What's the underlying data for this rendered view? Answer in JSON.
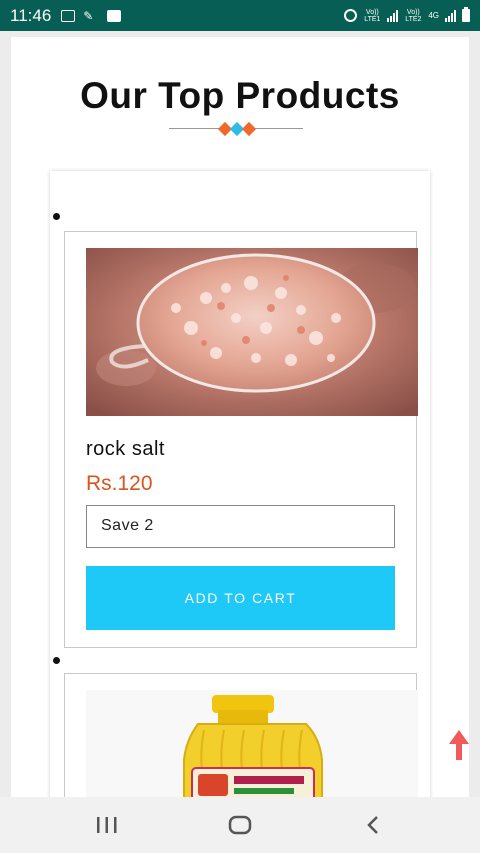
{
  "status_bar": {
    "time": "11:46",
    "sim1_label": "Vo)) LTE1",
    "sim2_label": "Vo)) LTE2",
    "network_type": "4G",
    "icons": [
      "image-icon",
      "magic-wand-icon",
      "checkbox-icon",
      "alarm-icon",
      "signal-icon",
      "battery-icon"
    ]
  },
  "section": {
    "title": "Our Top Products",
    "divider_colors": [
      "#f0692a",
      "#2ebbe8",
      "#f0692a"
    ]
  },
  "products": [
    {
      "name": "rock salt",
      "price": "Rs.120",
      "variant": "Save 2",
      "add_to_cart_label": "ADD TO CART",
      "image": "pink-rock-salt-crystals-photo"
    },
    {
      "image": "yellow-oil-jar-photo"
    }
  ],
  "colors": {
    "status_bar": "#075e54",
    "price": "#d9541e",
    "add_to_cart_button": "#1ec8f7",
    "scroll_top_arrow": "#f05a5a"
  },
  "nav_bar": {
    "icons": [
      "recent-apps-icon",
      "home-icon",
      "back-icon"
    ]
  }
}
